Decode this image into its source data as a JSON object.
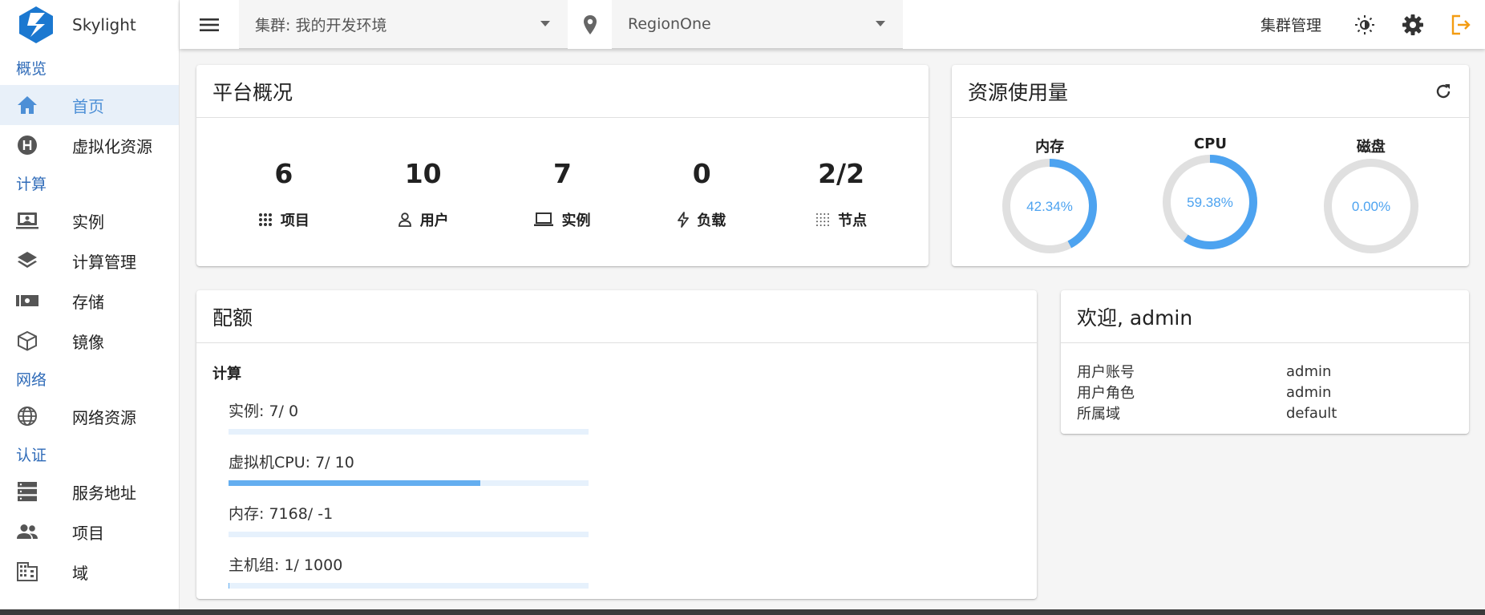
{
  "app": {
    "name": "Skylight"
  },
  "sidebar": {
    "groups": [
      {
        "title": "概览",
        "items": [
          {
            "label": "首页",
            "icon": "home-icon",
            "active": true
          },
          {
            "label": "虚拟化资源",
            "icon": "hypervisor-icon"
          }
        ]
      },
      {
        "title": "计算",
        "items": [
          {
            "label": "实例",
            "icon": "monitor-icon"
          },
          {
            "label": "计算管理",
            "icon": "layers-icon"
          },
          {
            "label": "存储",
            "icon": "storage-icon"
          },
          {
            "label": "镜像",
            "icon": "cube-icon"
          }
        ]
      },
      {
        "title": "网络",
        "items": [
          {
            "label": "网络资源",
            "icon": "globe-icon"
          }
        ]
      },
      {
        "title": "认证",
        "items": [
          {
            "label": "服务地址",
            "icon": "server-icon"
          },
          {
            "label": "项目",
            "icon": "group-icon"
          },
          {
            "label": "域",
            "icon": "building-icon"
          }
        ]
      }
    ]
  },
  "topbar": {
    "cluster_select": "集群: 我的开发环境",
    "region_select": "RegionOne",
    "cluster_management": "集群管理"
  },
  "overview": {
    "title": "平台概况",
    "stats": [
      {
        "value": "6",
        "label": "项目",
        "icon": "grid-icon"
      },
      {
        "value": "10",
        "label": "用户",
        "icon": "user-icon"
      },
      {
        "value": "7",
        "label": "实例",
        "icon": "laptop-icon"
      },
      {
        "value": "0",
        "label": "负载",
        "icon": "bolt-icon"
      },
      {
        "value": "2/2",
        "label": "节点",
        "icon": "dots-grid-icon"
      }
    ]
  },
  "usage": {
    "title": "资源使用量",
    "gauges": [
      {
        "label": "内存",
        "value_text": "42.34%",
        "fraction": 0.4234
      },
      {
        "label": "CPU",
        "value_text": "59.38%",
        "fraction": 0.5938
      },
      {
        "label": "磁盘",
        "value_text": "0.00%",
        "fraction": 0.0
      }
    ]
  },
  "quota": {
    "title": "配额",
    "section": "计算",
    "items": [
      {
        "label": "实例: 7/ 0",
        "fraction": 0
      },
      {
        "label": "虚拟机CPU: 7/ 10",
        "fraction": 0.7
      },
      {
        "label": "内存: 7168/ -1",
        "fraction": 0
      },
      {
        "label": "主机组: 1/ 1000",
        "fraction": 0.001
      }
    ]
  },
  "welcome": {
    "title": "欢迎, admin",
    "rows": [
      {
        "key": "用户账号",
        "value": "admin"
      },
      {
        "key": "用户角色",
        "value": "admin"
      },
      {
        "key": "所属域",
        "value": "default"
      }
    ]
  },
  "colors": {
    "accent": "#4da3f0",
    "gauge_track": "#e0e0e0",
    "group_title": "#2f6bb8",
    "logout": "#f39c12"
  }
}
